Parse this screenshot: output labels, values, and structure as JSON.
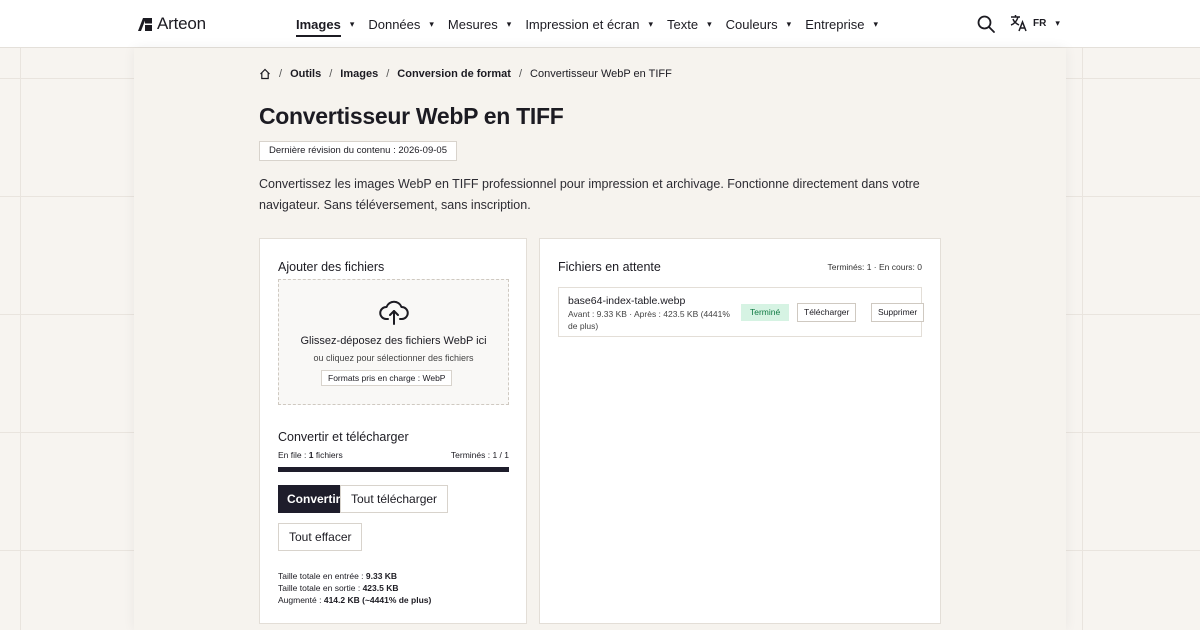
{
  "header": {
    "logo_text": "Arteon",
    "nav": [
      {
        "label": "Images",
        "active": true
      },
      {
        "label": "Données",
        "active": false
      },
      {
        "label": "Mesures",
        "active": false
      },
      {
        "label": "Impression et écran",
        "active": false
      },
      {
        "label": "Texte",
        "active": false
      },
      {
        "label": "Couleurs",
        "active": false
      },
      {
        "label": "Entreprise",
        "active": false
      }
    ],
    "caret": "▾",
    "search_icon": "search-icon",
    "language": {
      "icon": "translate-icon",
      "code": "FR"
    }
  },
  "breadcrumb": {
    "home_icon": "home-icon",
    "separator": "/",
    "items": [
      "Outils",
      "Images",
      "Conversion de format"
    ],
    "current": "Convertisseur WebP en TIFF"
  },
  "page": {
    "title": "Convertisseur WebP en TIFF",
    "revision": "Dernière révision du contenu : 2026-09-05",
    "intro": "Convertissez les images WebP en TIFF professionnel pour impression et archivage. Fonctionne directement dans votre navigateur. Sans téléversement, sans inscription."
  },
  "upload": {
    "title": "Ajouter des fichiers",
    "icon": "cloud-upload-icon",
    "drop_text": "Glissez-déposez des fichiers WebP ici",
    "click_text": "ou cliquez pour sélectionner des fichiers",
    "formats": "Formats pris en charge : WebP"
  },
  "convert": {
    "title": "Convertir et télécharger",
    "queue_label": "En file : ",
    "queue_value": "1",
    "queue_suffix": " fichiers",
    "done": "Terminés : 1 / 1",
    "progress": 1.0,
    "convert_button": "Convertir",
    "download_all_button": "Tout télécharger",
    "clear_button": "Tout effacer"
  },
  "stats": {
    "input_label": "Taille totale en entrée : ",
    "input_value": "9.33 KB",
    "output_label": "Taille totale en sortie : ",
    "output_value": "423.5 KB",
    "increase_label": "Augmenté : ",
    "increase_value": "414.2 KB (~4441% de plus)"
  },
  "pending": {
    "title": "Fichiers en attente",
    "status": "Terminés: 1 · En cours: 0",
    "files": [
      {
        "name": "base64-index-table.webp",
        "meta": "Avant : 9.33 KB · Après : 423.5 KB (4441% de plus)",
        "status": "Terminé",
        "download": "Télécharger",
        "delete": "Supprimer"
      }
    ]
  },
  "colors": {
    "accent": "#1e1d2b",
    "success_bg": "#d6f3e3",
    "success_text": "#0f7a43",
    "background": "#f7f4f0"
  }
}
